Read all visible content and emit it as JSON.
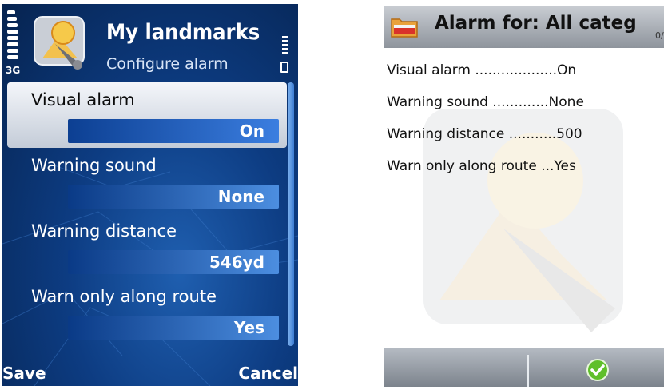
{
  "left": {
    "title": "My landmarks",
    "subtitle": "Configure alarm",
    "network": "3G",
    "items": [
      {
        "label": "Visual alarm",
        "value": "On"
      },
      {
        "label": "Warning sound",
        "value": "None"
      },
      {
        "label": "Warning distance",
        "value": "546yd"
      },
      {
        "label": "Warn only along route",
        "value": "Yes"
      }
    ],
    "softkeys": {
      "left": "Save",
      "right": "Cancel"
    }
  },
  "right": {
    "title": "Alarm for: All categ",
    "count": "0/",
    "rows": [
      {
        "text": "Visual alarm ...................On"
      },
      {
        "text": "Warning sound .............None"
      },
      {
        "text": "Warning distance ...........500"
      },
      {
        "text": "Warn only along route ...Yes"
      }
    ]
  },
  "colors": {
    "left_background": "#0d3c82",
    "value_bar": "#3b7ee0",
    "selected_item": "#e6eaf0",
    "right_header": "#8e949c",
    "ok_icon": "#5fbf2a"
  },
  "icons": [
    "signal-strength-icon",
    "battery-icon",
    "landmarks-app-icon",
    "scroll-bar",
    "folder-icon",
    "ok-check-icon",
    "landmarks-watermark-icon"
  ]
}
